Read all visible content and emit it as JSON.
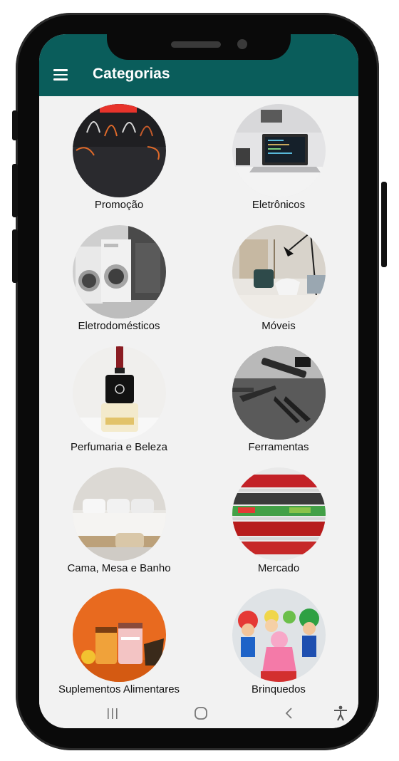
{
  "header": {
    "title": "Categorias",
    "menu_icon": "hamburger-menu-icon"
  },
  "colors": {
    "app_bar": "#0a5d5b",
    "background": "#f2f2f2"
  },
  "categories": [
    {
      "label": "Promoção",
      "image": "shopping-bags-image"
    },
    {
      "label": "Eletrônicos",
      "image": "laptop-image"
    },
    {
      "label": "Eletrodomésticos",
      "image": "washing-machines-image"
    },
    {
      "label": "Móveis",
      "image": "living-room-furniture-image"
    },
    {
      "label": "Perfumaria e Beleza",
      "image": "perfume-bottle-image"
    },
    {
      "label": "Ferramentas",
      "image": "hand-tools-image"
    },
    {
      "label": "Cama, Mesa e Banho",
      "image": "bed-image"
    },
    {
      "label": "Mercado",
      "image": "supermarket-shelves-image"
    },
    {
      "label": "Suplementos Alimentares",
      "image": "supplement-jars-image"
    },
    {
      "label": "Brinquedos",
      "image": "toy-figures-image"
    }
  ],
  "navigation": {
    "recents_icon": "recents-icon",
    "home_icon": "home-icon",
    "back_icon": "back-icon",
    "accessibility_icon": "accessibility-icon"
  }
}
